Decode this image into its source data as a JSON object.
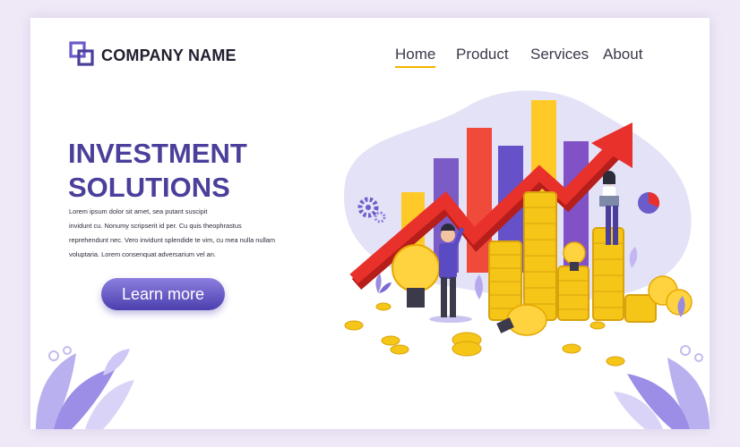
{
  "brand": {
    "name": "COMPANY NAME",
    "logo_icon": "overlapping-squares-logo-icon"
  },
  "nav": {
    "items": [
      {
        "label": "Home",
        "active": true
      },
      {
        "label": "Product",
        "active": false
      },
      {
        "label": "Services",
        "active": false
      },
      {
        "label": "About",
        "active": false
      }
    ]
  },
  "hero": {
    "title_line1": "INVESTMENT",
    "title_line2": "SOLUTIONS",
    "body_lines": [
      "Lorem ipsum dolor sit amet, sea putant suscipit",
      "invidunt cu. Nonumy scripserit id per. Cu quis theophrastus",
      "reprehendunt nec. Vero invidunt splendide te vim, cu mea nulla nullam",
      "voluptaria. Lorem consenquat adversarium vel an."
    ],
    "cta_label": "Learn more"
  },
  "illustration": {
    "subject": "growth-chart-with-coins-and-lightbulbs",
    "colors": {
      "accent_purple": "#4a3f9a",
      "arrow_red": "#e8312a",
      "coin_gold": "#f5c518",
      "bar_yellow": "#ffc928",
      "blob": "#e4e2f7"
    }
  }
}
